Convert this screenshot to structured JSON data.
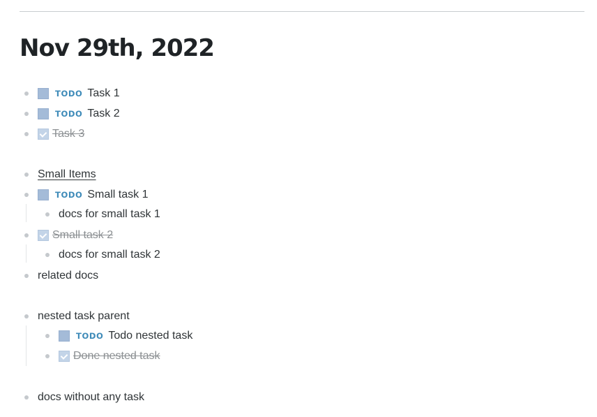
{
  "page": {
    "title": "Nov 29th, 2022"
  },
  "marker": "TODO",
  "blocks": {
    "task1": "Task 1",
    "task2": "Task 2",
    "task3": "Task 3",
    "small_items": "Small Items",
    "small_task1": "Small task 1",
    "docs_small1": "docs for small task 1",
    "small_task2": "Small task 2",
    "docs_small2": "docs for small task 2",
    "related_docs": "related docs",
    "nested_parent": "nested task parent",
    "todo_nested": "Todo nested task",
    "done_nested": "Done nested task",
    "docs_without": "docs without any task"
  },
  "colors": {
    "todo_marker": "#3d8ab8",
    "checkbox_unchecked": "#a4bbd8",
    "checkbox_checked": "#c3d4e8",
    "bullet": "#c5c9cd",
    "done_text": "#8b8f92"
  }
}
